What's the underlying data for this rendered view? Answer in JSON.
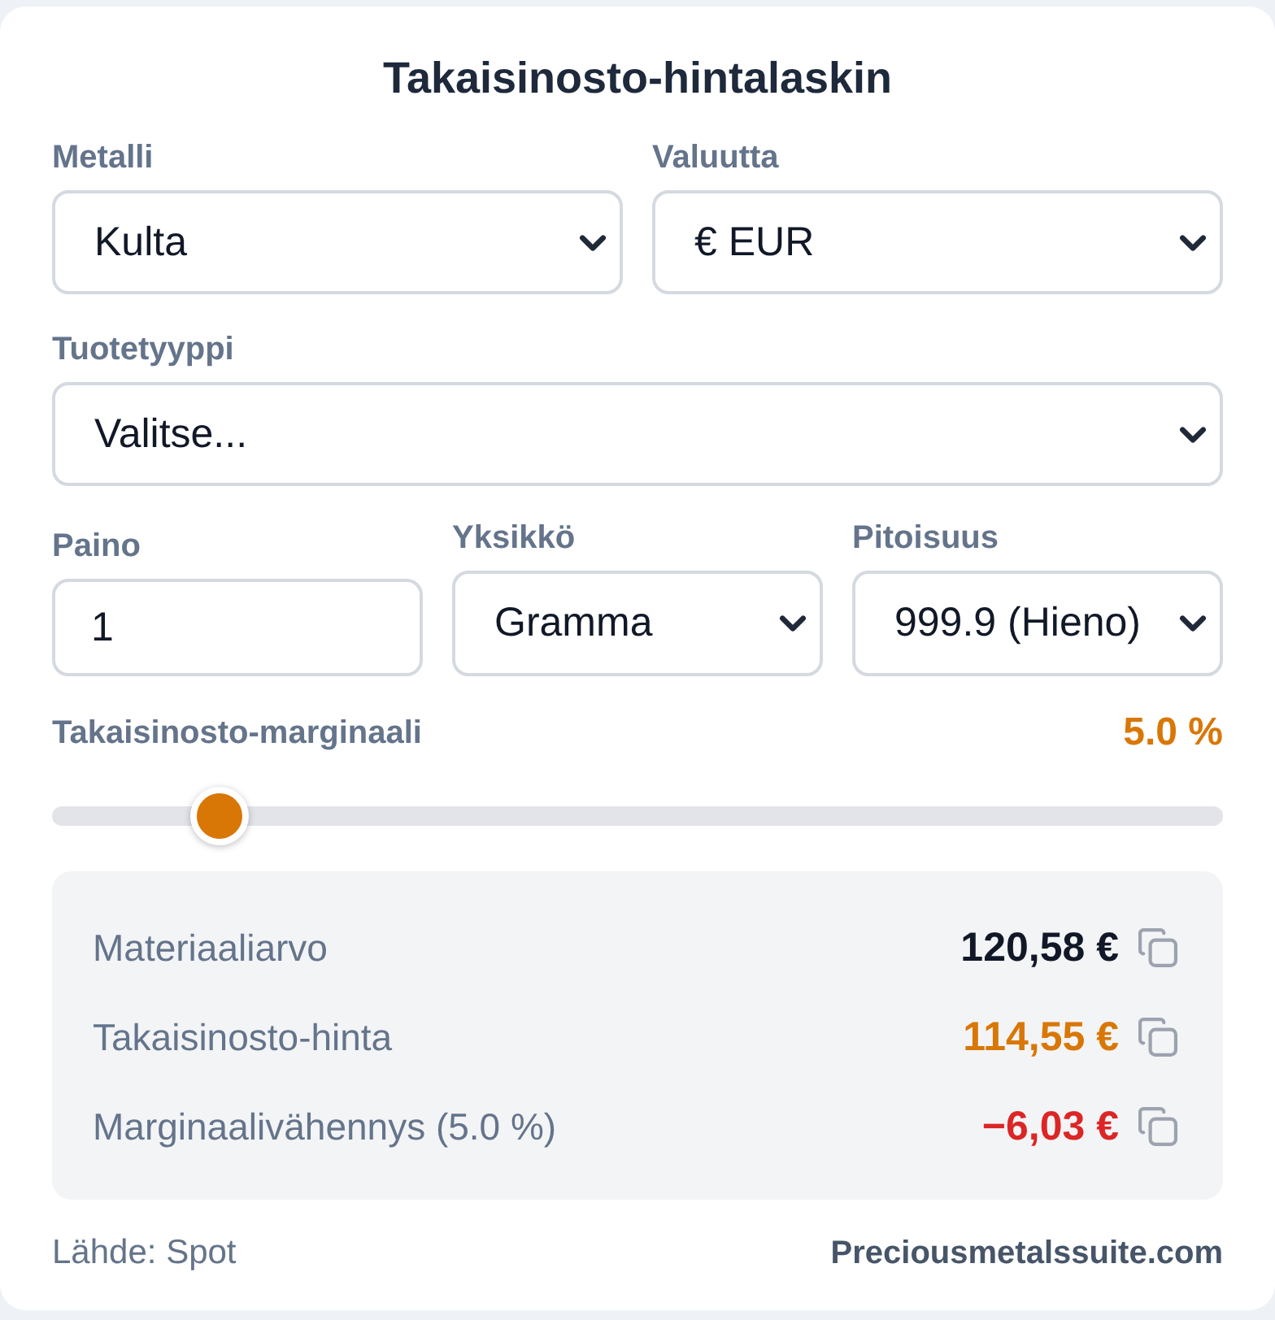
{
  "title": "Takaisinosto-hintalaskin",
  "rows": [
    {
      "fields": [
        {
          "kind": "select",
          "label": "Metalli",
          "value": "Kulta"
        },
        {
          "kind": "select",
          "label": "Valuutta",
          "value": "€ EUR"
        }
      ]
    },
    {
      "fields": [
        {
          "kind": "select",
          "label": "Tuotetyyppi",
          "value": "Valitse..."
        }
      ]
    },
    {
      "fields": [
        {
          "kind": "input",
          "label": "Paino",
          "value": "1"
        },
        {
          "kind": "select",
          "label": "Yksikkö",
          "value": "Gramma"
        },
        {
          "kind": "select",
          "label": "Pitoisuus",
          "value": "999.9 (Hieno)"
        }
      ]
    }
  ],
  "margin": {
    "label": "Takaisinosto-marginaali",
    "reading": "5.0 %",
    "level": 0.143
  },
  "results": [
    {
      "label": "Materiaaliarvo",
      "value": "120,58 €",
      "color": "#111827"
    },
    {
      "label": "Takaisinosto-hinta",
      "value": "114,55 €",
      "color": "#d97706"
    },
    {
      "label": "Marginaalivähennys (5.0 %)",
      "value": "−6,03 €",
      "color": "#dc2626"
    }
  ],
  "footer": {
    "source": "Lähde: Spot",
    "brand": "Preciousmetalssuite.com"
  }
}
